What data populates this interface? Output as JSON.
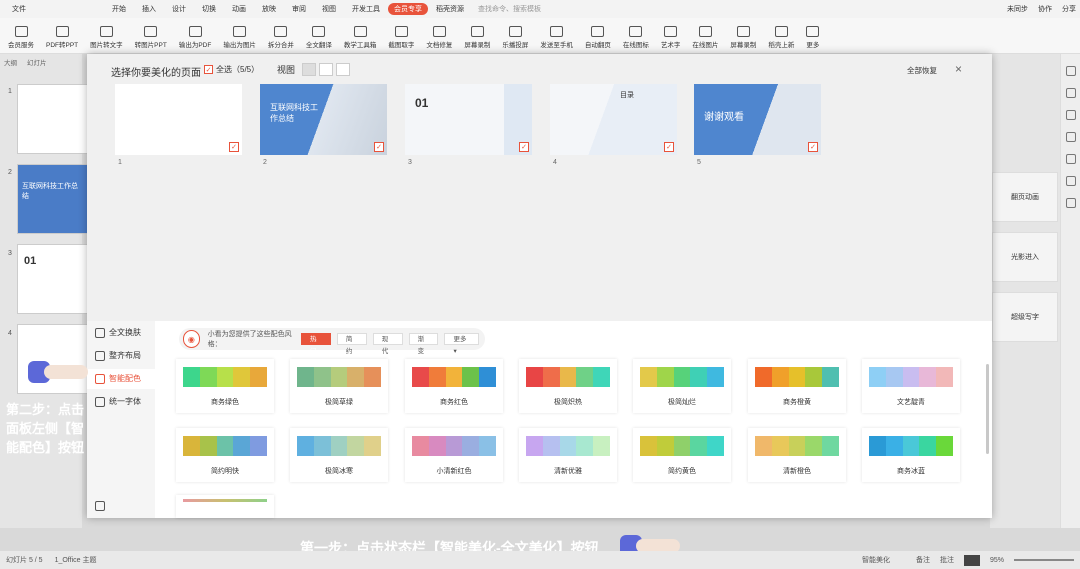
{
  "titlebar": {
    "menus": [
      "文件",
      "开始",
      "插入",
      "设计",
      "切换",
      "动画",
      "放映",
      "审阅",
      "视图",
      "开发工具",
      "会员专享",
      "稻壳资源"
    ],
    "active_menu": "会员专享",
    "search": "查找命令、搜索模板",
    "right": [
      "未同步",
      "协作",
      "分享"
    ]
  },
  "ribbon": {
    "buttons": [
      "会员服务",
      "PDF转PPT",
      "图片转文字",
      "转图片PPT",
      "输出为PDF",
      "输出为图片",
      "拆分合并",
      "全文翻译",
      "教学工具箱",
      "截图取字",
      "文档修复",
      "屏幕录制",
      "乐播投屏",
      "发送至手机",
      "自动翻页",
      "在线图标",
      "艺术字",
      "在线图片",
      "屏幕录制",
      "稻壳上新",
      "更多"
    ]
  },
  "sidebar": {
    "tabs": [
      "大纲",
      "幻灯片"
    ],
    "slide_numbers": [
      "1",
      "2",
      "3",
      "4"
    ],
    "slide2_title": "互联网科技工作总结",
    "slide3_title": "01"
  },
  "right_panel": {
    "cards": [
      "翻页动画",
      "光影进入",
      "超级写字"
    ]
  },
  "modal": {
    "title": "选择你要美化的页面",
    "select_all": "全选（5/5）",
    "view_label": "视图",
    "restore": "全部恢复",
    "slides": [
      {
        "num": "1",
        "title": ""
      },
      {
        "num": "2",
        "title": "互联网科技工作总结"
      },
      {
        "num": "3",
        "title": "01"
      },
      {
        "num": "4",
        "title": "目录"
      },
      {
        "num": "5",
        "title": "谢谢观看"
      }
    ],
    "left_menu": [
      "全文换肤",
      "整齐布局",
      "智能配色",
      "统一字体"
    ],
    "active_menu": "智能配色",
    "filter": {
      "prompt": "小看为您提供了这些配色风格：",
      "buttons": [
        "热门",
        "简约",
        "现代",
        "渐变",
        "更多"
      ],
      "active": "热门"
    },
    "schemes": [
      {
        "name": "商务绿色",
        "colors": [
          "#3dd68c",
          "#7ed957",
          "#b7e04a",
          "#e0c73a",
          "#e8a83a"
        ]
      },
      {
        "name": "极简草绿",
        "colors": [
          "#6fb58c",
          "#8fc28a",
          "#b5cc7c",
          "#d8b06a",
          "#e6905a"
        ]
      },
      {
        "name": "商务红色",
        "colors": [
          "#e84a4a",
          "#f07c3a",
          "#f2b33a",
          "#6cc24a",
          "#2f8fd6"
        ]
      },
      {
        "name": "极简炽热",
        "colors": [
          "#e84545",
          "#ef6d4a",
          "#e9b84a",
          "#6fd187",
          "#3fd6b8"
        ]
      },
      {
        "name": "极简灿烂",
        "colors": [
          "#e3c94a",
          "#9fd54a",
          "#57d27a",
          "#3fd0b5",
          "#3fb9e0"
        ]
      },
      {
        "name": "商务橙黄",
        "colors": [
          "#f06a2a",
          "#f0a02a",
          "#e6c02a",
          "#a8c83a",
          "#4fbfb0"
        ]
      },
      {
        "name": "文艺靛青",
        "colors": [
          "#8ecff5",
          "#a7c8f2",
          "#c9bdf0",
          "#e8b8d8",
          "#f2b8b8"
        ]
      },
      {
        "name": "简约明快",
        "colors": [
          "#d9b53a",
          "#a8c24a",
          "#6cc2a8",
          "#5aa6d6",
          "#7f9be0"
        ]
      },
      {
        "name": "极简冰寒",
        "colors": [
          "#5fb0e0",
          "#7cc0d8",
          "#9fd0c2",
          "#c2d6a0",
          "#e0d08a"
        ]
      },
      {
        "name": "小清新红色",
        "colors": [
          "#e88aa0",
          "#d88ac0",
          "#b89ad6",
          "#9aaee0",
          "#8ac0e6"
        ]
      },
      {
        "name": "清新优雅",
        "colors": [
          "#c7a6f0",
          "#b6c0f0",
          "#a8d8e8",
          "#a8e8d0",
          "#c8f0c0"
        ]
      },
      {
        "name": "简约黄色",
        "colors": [
          "#d9c23a",
          "#c0cc3a",
          "#8fd06a",
          "#5ad6a0",
          "#3fd6c8"
        ]
      },
      {
        "name": "清新橙色",
        "colors": [
          "#f0b86a",
          "#e8c85a",
          "#c8d05a",
          "#9ad86a",
          "#6fd8a0"
        ]
      },
      {
        "name": "商务冰蓝",
        "colors": [
          "#2a9ad6",
          "#3ab0e6",
          "#4ac8d8",
          "#3ad6a0",
          "#6ad83a"
        ]
      }
    ]
  },
  "instructions": {
    "step1": "第一步：点击状态栏【智能美化-全文美化】按钮",
    "step2": "第二步：点击面板左侧【智能配色】按钮"
  },
  "status": {
    "page": "幻灯片 5 / 5",
    "theme": "1_Office 主题",
    "beautify": "智能美化",
    "notes": "备注",
    "comments": "批注",
    "zoom": "95%"
  }
}
